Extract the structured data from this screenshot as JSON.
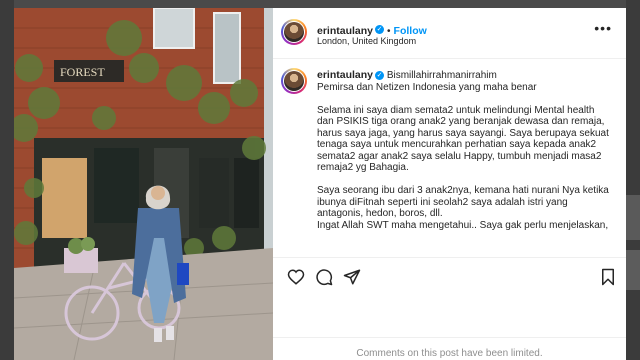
{
  "post": {
    "username": "erintaulany",
    "follow_label": "Follow",
    "dot": "•",
    "location": "London, United Kingdom",
    "more_label": "•••",
    "caption_first": "Bismillahirrahmanirrahim",
    "caption_rest": "Pemirsa dan Netizen Indonesia yang maha benar\n\nSelama ini saya diam semata2 untuk melindungi Mental health\ndan PSIKIS tiga orang anak2 yang beranjak dewasa dan remaja,\nharus saya jaga, yang harus saya sayangi. Saya berupaya sekuat\ntenaga saya untuk mencurahkan perhatian saya kepada anak2\nsemata2 agar anak2 saya selalu Happy, tumbuh menjadi masa2\nremaja2 yg Bahagia.\n\nSaya seorang ibu dari 3 anak2nya, kemana hati nurani Nya ketika\nibunya diFitnah seperti ini seolah2 saya adalah istri yang\nantagonis, hedon, boros, dll.\nIngat Allah SWT maha mengetahui.. Saya gak perlu menjelaskan,",
    "comments_notice": "Comments on this post have been limited.",
    "verified_mark": "✓"
  },
  "photo": {
    "sign_text": "FOREST"
  },
  "icons": {
    "like": "heart-icon",
    "comment": "comment-icon",
    "share": "share-icon",
    "save": "bookmark-icon"
  },
  "colors": {
    "accent": "#0095f6",
    "text": "#262626",
    "muted": "#8e8e8e"
  }
}
